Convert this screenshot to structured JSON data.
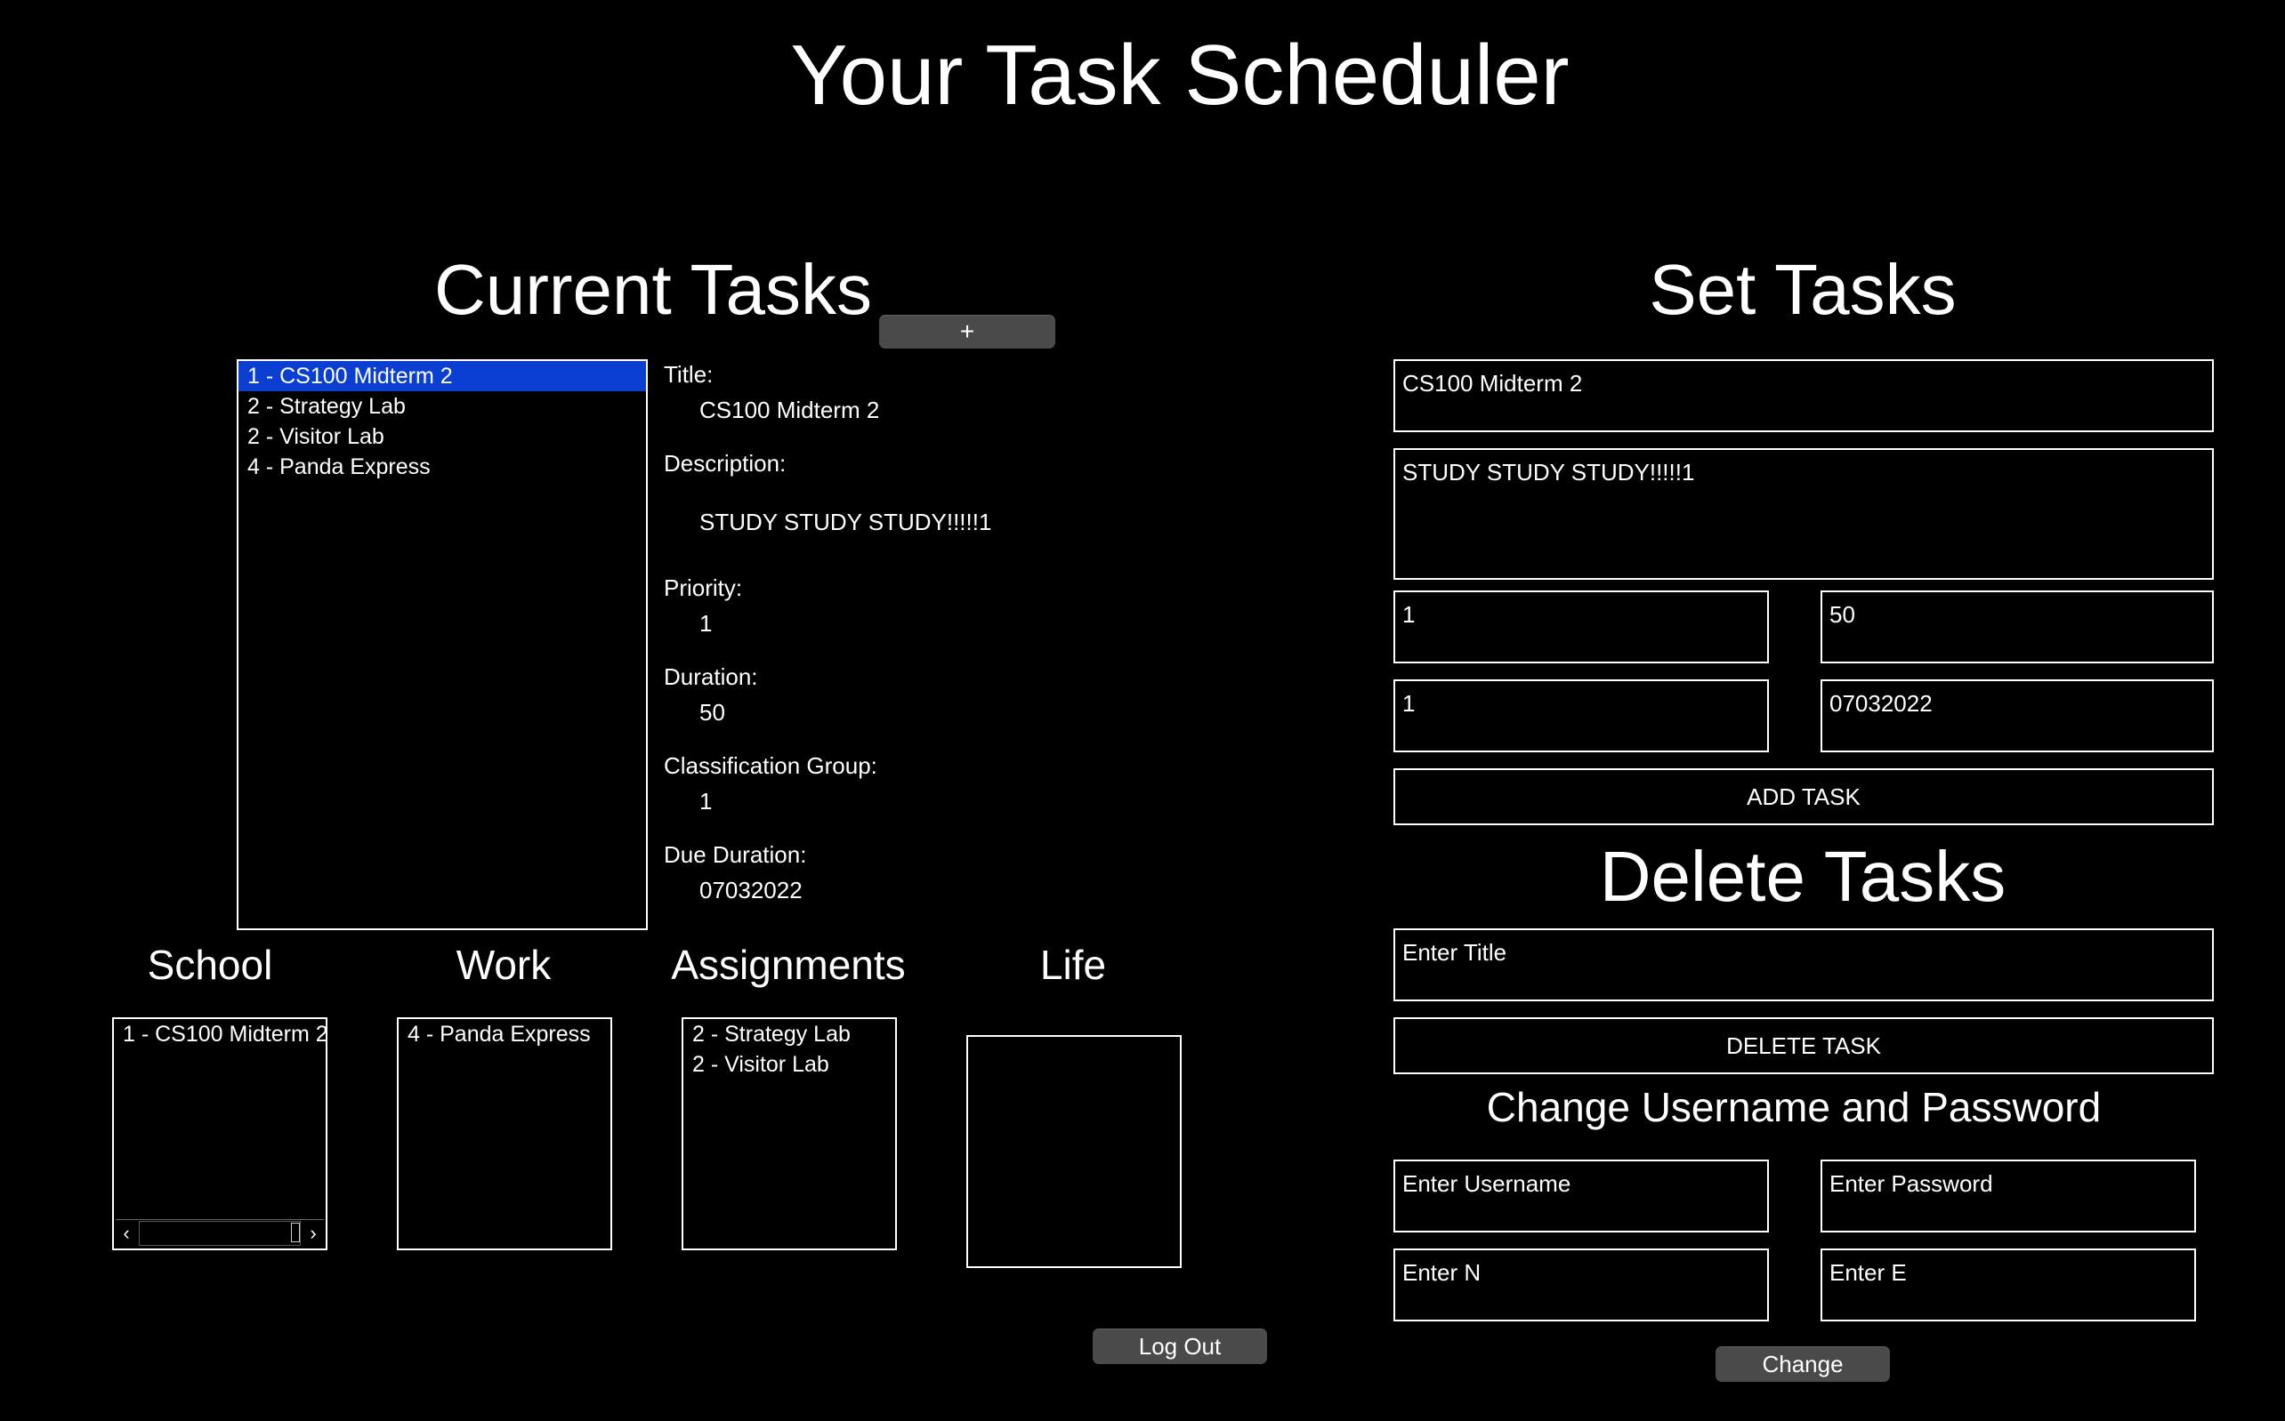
{
  "app": {
    "title": "Your Task Scheduler"
  },
  "current_tasks": {
    "heading": "Current Tasks",
    "add_button_label": "+",
    "list": [
      {
        "label": "1 - CS100 Midterm 2",
        "selected": true
      },
      {
        "label": "2 - Strategy Lab",
        "selected": false
      },
      {
        "label": "2 - Visitor Lab",
        "selected": false
      },
      {
        "label": "4 - Panda Express",
        "selected": false
      }
    ],
    "selection_color": "#0a3fd1"
  },
  "details": {
    "title_label": "Title:",
    "title_value": "CS100 Midterm 2",
    "description_label": "Description:",
    "description_value": "STUDY STUDY STUDY!!!!!1",
    "priority_label": "Priority:",
    "priority_value": "1",
    "duration_label": "Duration:",
    "duration_value": "50",
    "group_label": "Classification Group:",
    "group_value": "1",
    "due_label": "Due Duration:",
    "due_value": "07032022"
  },
  "categories": {
    "school": {
      "heading": "School",
      "items": [
        "1 - CS100 Midterm 2"
      ]
    },
    "work": {
      "heading": "Work",
      "items": [
        "4 - Panda Express"
      ]
    },
    "assignments": {
      "heading": "Assignments",
      "items": [
        "2 - Strategy Lab",
        "2 - Visitor Lab"
      ]
    },
    "life": {
      "heading": "Life",
      "items": []
    }
  },
  "logout_label": "Log Out",
  "set_tasks": {
    "heading": "Set Tasks",
    "title_value": "CS100 Midterm 2",
    "description_value": "STUDY STUDY STUDY!!!!!1",
    "priority_value": "1",
    "duration_value": "50",
    "group_value": "1",
    "due_value": "07032022",
    "add_button_label": "ADD TASK"
  },
  "delete_tasks": {
    "heading": "Delete Tasks",
    "title_placeholder": "Enter Title",
    "delete_button_label": "DELETE TASK"
  },
  "change_credentials": {
    "heading": "Change Username and Password",
    "username_placeholder": "Enter Username",
    "password_placeholder": "Enter Password",
    "n_placeholder": "Enter N",
    "e_placeholder": "Enter E",
    "change_button_label": "Change"
  }
}
